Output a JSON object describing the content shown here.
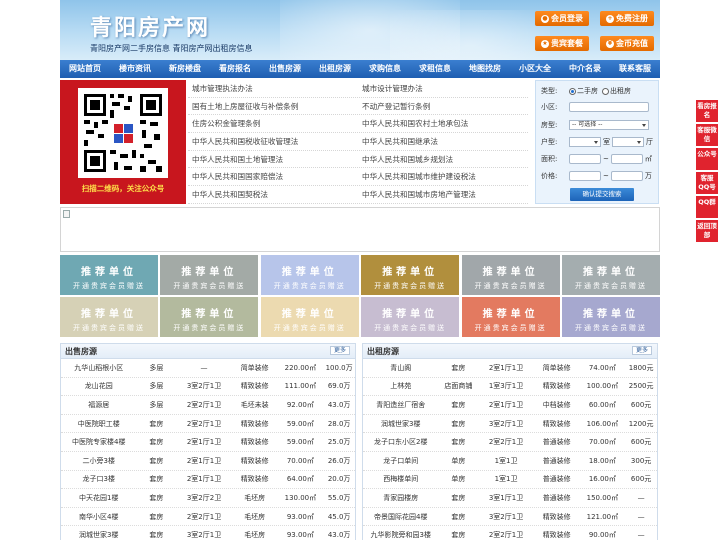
{
  "header": {
    "logo": "青阳房产网",
    "slogan": "青阳房产网二手房信息   青阳房产网出租房信息",
    "buttons": [
      {
        "label": "会员登录",
        "icon": "user-icon"
      },
      {
        "label": "免费注册",
        "icon": "register-icon"
      },
      {
        "label": "贵宾套餐",
        "icon": "vip-icon"
      },
      {
        "label": "金币充值",
        "icon": "coin-icon"
      }
    ]
  },
  "nav": [
    "网站首页",
    "楼市资讯",
    "新房楼盘",
    "看房报名",
    "出售房源",
    "出租房源",
    "求购信息",
    "求租信息",
    "地图找房",
    "小区大全",
    "中介名录",
    "联系客服"
  ],
  "qr": {
    "caption": "扫描二维码，关注公众号"
  },
  "laws": [
    [
      "城市管理执法办法",
      "城市设计管理办法"
    ],
    [
      "国有土地上房屋征收与补偿条例",
      "不动产登记暂行条例"
    ],
    [
      "住房公积金管理条例",
      "中华人民共和国农村土地承包法"
    ],
    [
      "中华人民共和国税收征收管理法",
      "中华人民共和国继承法"
    ],
    [
      "中华人民共和国土地管理法",
      "中华人民共和国城乡规划法"
    ],
    [
      "中华人民共和国国家赔偿法",
      "中华人民共和国城市维护建设税法"
    ],
    [
      "中华人民共和国契税法",
      "中华人民共和国城市房地产管理法"
    ]
  ],
  "search": {
    "type_label": "类型:",
    "type_options": [
      "二手房",
      "出租房"
    ],
    "community_label": "小区:",
    "housetype_label": "房型:",
    "housetype_value": "-- 可选择 --",
    "layout_label": "户型:",
    "room_unit": "室",
    "hall_unit": "厅",
    "area_label": "面积:",
    "area_unit": "㎡",
    "price_label": "价格:",
    "price_unit": "万",
    "range_sep": "~",
    "submit": "确认提交搜索"
  },
  "ads": {
    "title": "推荐单位",
    "subtitle": "开通贵宾会员赠送"
  },
  "colors": {
    "ad_tiles": [
      "#6fa8b3",
      "#a3aaa6",
      "#b7c5ea",
      "#b18f3d",
      "#a1a7aa",
      "#a4adaf",
      "#d6d1b6",
      "#b3ba9e",
      "#ecdab0",
      "#c7bdd1",
      "#e37a60",
      "#a6a8cf"
    ],
    "accent_red": "#c8161e",
    "nav_blue": "#1e5eb1"
  },
  "sale": {
    "title": "出售房源",
    "more": "更多",
    "rows": [
      [
        "九华山稻根小区",
        "多层",
        "—",
        "简单装修",
        "220.00㎡",
        "100.0万"
      ],
      [
        "龙山花园",
        "多层",
        "3室2厅1卫",
        "精致装修",
        "111.00㎡",
        "69.0万"
      ],
      [
        "福源居",
        "多层",
        "2室2厅1卫",
        "毛坯未装",
        "92.00㎡",
        "43.0万"
      ],
      [
        "中医院职工楼",
        "套房",
        "2室2厅1卫",
        "精致装修",
        "59.00㎡",
        "28.0万"
      ],
      [
        "中医院专家楼4楼",
        "套房",
        "2室1厅1卫",
        "精致装修",
        "59.00㎡",
        "25.0万"
      ],
      [
        "二小旁3楼",
        "套房",
        "2室1厅1卫",
        "精致装修",
        "70.00㎡",
        "26.0万"
      ],
      [
        "龙子口3楼",
        "套房",
        "2室1厅1卫",
        "精致装修",
        "64.00㎡",
        "20.0万"
      ],
      [
        "中天花园1楼",
        "套房",
        "3室2厅2卫",
        "毛坯房",
        "130.00㎡",
        "55.0万"
      ],
      [
        "南华小区4楼",
        "套房",
        "2室2厅1卫",
        "毛坯房",
        "93.00㎡",
        "45.0万"
      ],
      [
        "润城世家3楼",
        "套房",
        "3室2厅1卫",
        "毛坯房",
        "93.00㎡",
        "43.0万"
      ]
    ]
  },
  "rent": {
    "title": "出租房源",
    "more": "更多",
    "rows": [
      [
        "青山阁",
        "套房",
        "2室1厅1卫",
        "简单装修",
        "74.00㎡",
        "1800元"
      ],
      [
        "上林苑",
        "店面商铺",
        "1室3厅1卫",
        "精致装修",
        "100.00㎡",
        "2500元"
      ],
      [
        "青阳造丝厂宿舍",
        "套房",
        "2室1厅1卫",
        "中档装修",
        "60.00㎡",
        "600元"
      ],
      [
        "润城世家3楼",
        "套房",
        "3室2厅1卫",
        "精致装修",
        "106.00㎡",
        "1200元"
      ],
      [
        "龙子口东小区2楼",
        "套房",
        "2室2厅1卫",
        "普通装修",
        "70.00㎡",
        "600元"
      ],
      [
        "龙子口单间",
        "单房",
        "1室1卫",
        "普通装修",
        "18.00㎡",
        "300元"
      ],
      [
        "西梅楼单间",
        "单房",
        "1室1卫",
        "普通装修",
        "16.00㎡",
        "600元"
      ],
      [
        "青家园楼房",
        "套房",
        "3室1厅1卫",
        "普通装修",
        "150.00㎡",
        "—"
      ],
      [
        "帝景国际花园4楼",
        "套房",
        "3室2厅1卫",
        "精致装修",
        "121.00㎡",
        "—"
      ],
      [
        "九华影院旁和园3楼",
        "套房",
        "2室2厅1卫",
        "精致装修",
        "90.00㎡",
        "—"
      ]
    ]
  },
  "float_bar": [
    "看房报名",
    "客服微信",
    "公众号",
    "客服QQ号",
    "QQ群",
    "返回顶部"
  ]
}
